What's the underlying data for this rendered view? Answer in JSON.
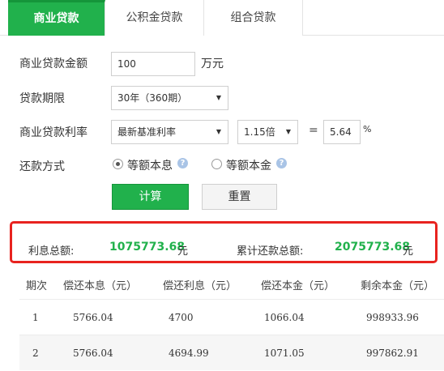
{
  "tabs": [
    {
      "label": "商业贷款",
      "active": true
    },
    {
      "label": "公积金贷款",
      "active": false
    },
    {
      "label": "组合贷款",
      "active": false
    }
  ],
  "form": {
    "amount_label": "商业贷款金额",
    "amount_value": "100",
    "amount_unit": "万元",
    "term_label": "贷款期限",
    "term_value": "30年（360期）",
    "rate_label": "商业贷款利率",
    "rate_type_value": "最新基准利率",
    "multiplier_value": "1.15倍",
    "equals_sign": "=",
    "rate_value": "5.64",
    "percent_sign": "%",
    "method_label": "还款方式",
    "method_options": [
      {
        "label": "等额本息",
        "selected": true
      },
      {
        "label": "等额本金",
        "selected": false
      }
    ],
    "calc_button": "计算",
    "reset_button": "重置"
  },
  "result": {
    "interest_label": "利息总额:",
    "interest_value": "1075773.68",
    "interest_unit": "元",
    "total_label": "累计还款总额:",
    "total_value": "2075773.68",
    "total_unit": "元"
  },
  "table": {
    "headers": [
      "期次",
      "偿还本息（元）",
      "偿还利息（元）",
      "偿还本金（元）",
      "剩余本金（元）"
    ],
    "rows": [
      [
        "1",
        "5766.04",
        "4700",
        "1066.04",
        "998933.96"
      ],
      [
        "2",
        "5766.04",
        "4694.99",
        "1071.05",
        "997862.91"
      ]
    ]
  },
  "colors": {
    "accent_green": "#21b14c",
    "highlight_red": "#e8231f"
  }
}
